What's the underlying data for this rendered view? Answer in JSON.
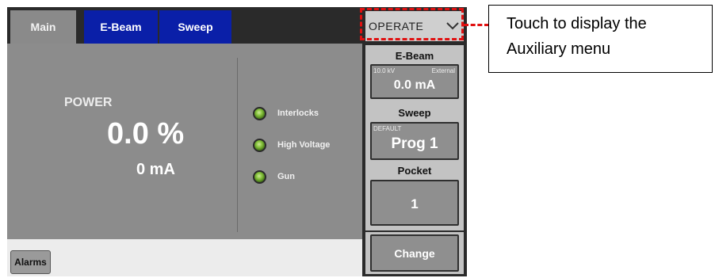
{
  "tabs": {
    "main": "Main",
    "ebeam": "E-Beam",
    "sweep": "Sweep"
  },
  "power": {
    "label": "POWER",
    "percent": "0.0 %",
    "current": "0 mA"
  },
  "indicators": [
    "Interlocks",
    "High Voltage",
    "Gun"
  ],
  "status_bar": {
    "alarms": "Alarms"
  },
  "operate": {
    "label": "OPERATE",
    "icon": "chevron-down-icon"
  },
  "ebeam_section": {
    "title": "E-Beam",
    "kv": "10.0 kV",
    "mode": "External",
    "value": "0.0 mA"
  },
  "sweep_section": {
    "title": "Sweep",
    "preset": "DEFAULT",
    "program": "Prog 1"
  },
  "pocket_section": {
    "title": "Pocket",
    "value": "1"
  },
  "change_button": "Change",
  "annotation": {
    "line1": "Touch to display the",
    "line2": "Auxiliary menu"
  },
  "colors": {
    "tab_active": "#8a8a8a",
    "tab_inactive": "#0a1fa8",
    "panel": "#8c8c8c",
    "led_green": "#86c33c",
    "annotation_red": "#e01010"
  }
}
